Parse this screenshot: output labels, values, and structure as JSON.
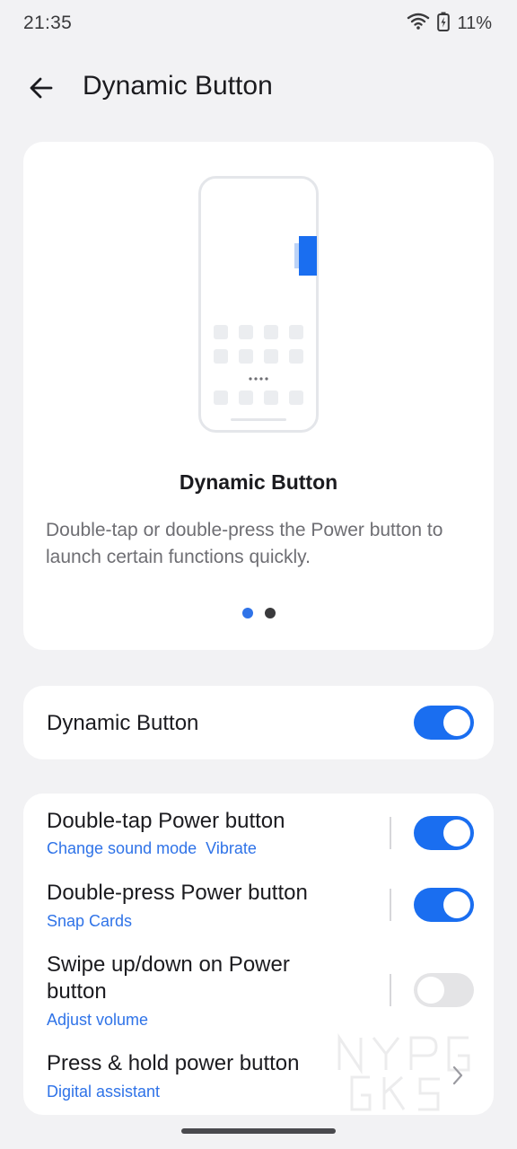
{
  "status_bar": {
    "time": "21:35",
    "battery_percent": "11%",
    "icons": [
      "wifi-icon",
      "battery-charging-icon"
    ]
  },
  "app_bar": {
    "title": "Dynamic Button",
    "back_icon": "arrow-left-icon"
  },
  "hero": {
    "title": "Dynamic Button",
    "description": "Double-tap or double-press the Power button to launch certain functions quickly.",
    "pager": {
      "count": 2,
      "active_index": 0
    }
  },
  "main_toggle": {
    "label": "Dynamic Button",
    "enabled": true
  },
  "options": [
    {
      "title": "Double-tap Power button",
      "subtitle_parts": [
        "Change sound mode",
        "Vibrate"
      ],
      "enabled": true
    },
    {
      "title": "Double-press Power button",
      "subtitle_parts": [
        "Snap Cards"
      ],
      "enabled": true
    },
    {
      "title": "Swipe up/down on Power button",
      "subtitle_parts": [
        "Adjust volume"
      ],
      "enabled": false
    },
    {
      "title": "Press & hold power button",
      "subtitle_parts": [
        "Digital assistant"
      ],
      "control": "chevron"
    }
  ],
  "colors": {
    "accent": "#1a6ef0",
    "link": "#2f73e8",
    "background": "#f2f2f4",
    "card": "#ffffff"
  }
}
